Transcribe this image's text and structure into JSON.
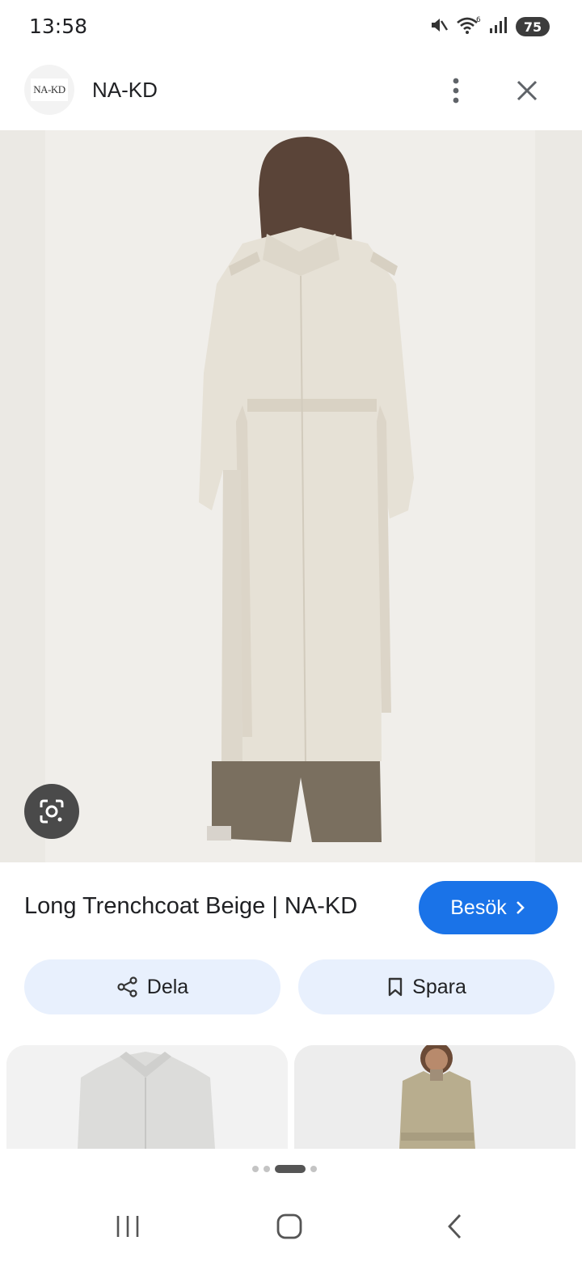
{
  "status_bar": {
    "time": "13:58",
    "battery": "75",
    "icons": [
      "mute-icon",
      "wifi-icon",
      "signal-icon",
      "battery-icon"
    ]
  },
  "header": {
    "logo_text": "NA-KD",
    "site_name": "NA-KD",
    "icons": [
      "more-vertical-icon",
      "close-icon"
    ]
  },
  "result": {
    "title": "Long Trenchcoat Beige | NA-KD",
    "visit_label": "Besök",
    "share_label": "Dela",
    "save_label": "Spara"
  },
  "pagination": {
    "count": 4,
    "active_index": 2
  },
  "colors": {
    "accent": "#1a73e8",
    "chip_bg": "#e8f0fd",
    "image_bg": "#eae8e2"
  }
}
